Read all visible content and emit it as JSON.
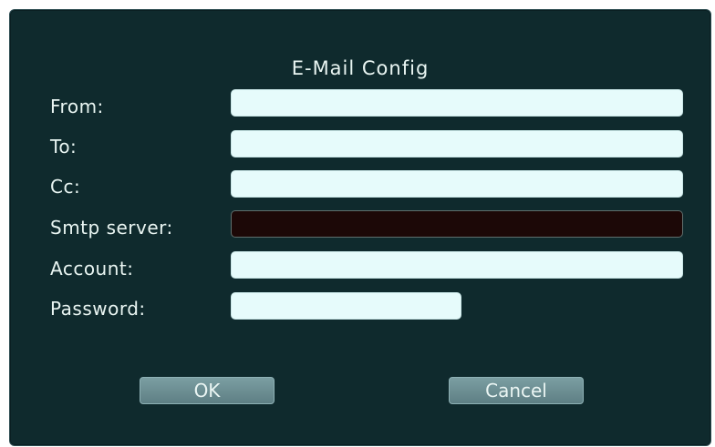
{
  "dialog": {
    "title": "E-Mail Config",
    "fields": [
      {
        "label": "From:",
        "value": ""
      },
      {
        "label": "To:",
        "value": ""
      },
      {
        "label": "Cc:",
        "value": ""
      },
      {
        "label": "Smtp server:",
        "value": ""
      },
      {
        "label": "Account:",
        "value": ""
      },
      {
        "label": "Password:",
        "value": ""
      }
    ],
    "ok_label": "OK",
    "cancel_label": "Cancel"
  },
  "colors": {
    "background": "#0f2a2d",
    "field": "#e6fbfb",
    "focused_field": "#1c0807",
    "button": "#6c8f94",
    "text": "#e9f5f2"
  }
}
